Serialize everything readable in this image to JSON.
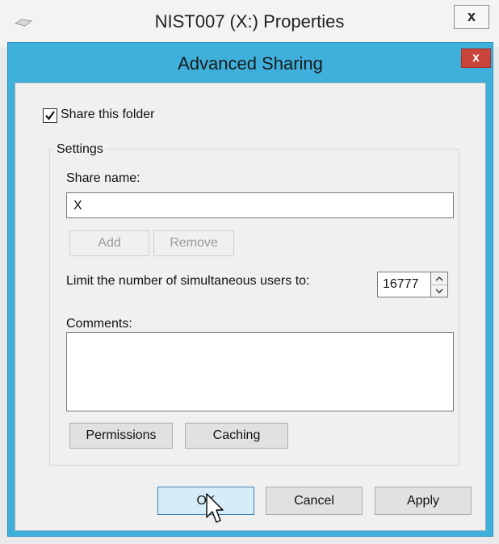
{
  "background_window": {
    "title": "NIST007 (X:) Properties",
    "close_label": "x"
  },
  "dialog": {
    "title": "Advanced Sharing",
    "close_label": "x",
    "share_checkbox": {
      "label": "Share this folder",
      "checked": true
    },
    "settings": {
      "legend": "Settings",
      "share_name_label": "Share name:",
      "share_name_value": "X",
      "add_label": "Add",
      "remove_label": "Remove",
      "limit_label": "Limit the number of simultaneous users to:",
      "limit_value": "16777",
      "comments_label": "Comments:",
      "comments_value": "",
      "permissions_label": "Permissions",
      "caching_label": "Caching"
    },
    "buttons": {
      "ok_label": "OK",
      "cancel_label": "Cancel",
      "apply_label": "Apply"
    }
  },
  "colors": {
    "dialog_frame": "#3fb0dc",
    "close_button": "#c9443a",
    "default_button": "#d7ecf9"
  }
}
